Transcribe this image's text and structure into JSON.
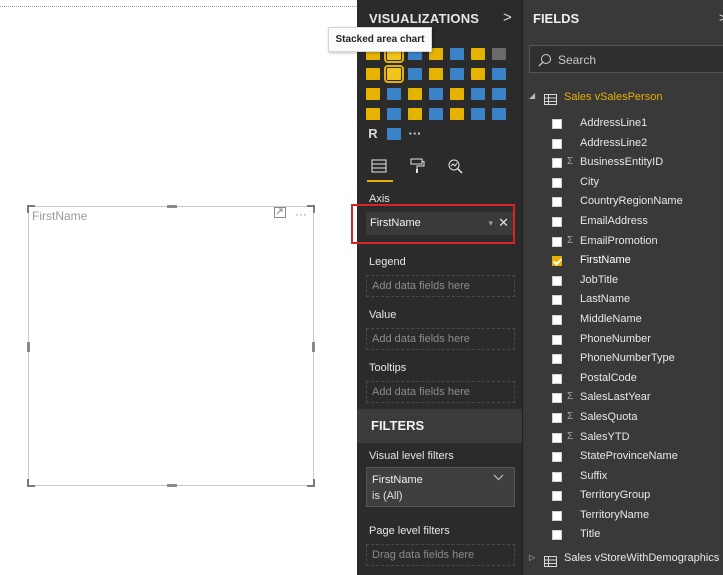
{
  "canvas": {
    "visual_title": "FirstName",
    "focus_icon": "focus-mode-icon",
    "more_icon": "···"
  },
  "visualizations": {
    "header": "VISUALIZATIONS",
    "collapse_glyph": ">",
    "tooltip": "Stacked area chart",
    "gallery": [
      {
        "name": "stacked-bar-chart-icon",
        "color": "#e6b400"
      },
      {
        "name": "stacked-column-chart-icon",
        "color": "#f0c419",
        "selected": true
      },
      {
        "name": "clustered-bar-chart-icon",
        "color": "#3b83c9"
      },
      {
        "name": "clustered-column-chart-icon",
        "color": "#e6b400"
      },
      {
        "name": "100-percent-bar-chart-icon",
        "color": "#3b83c9"
      },
      {
        "name": "100-percent-column-chart-icon",
        "color": "#e6b400"
      },
      {
        "name": "line-chart-icon",
        "color": "#6a6a6a"
      },
      {
        "name": "area-chart-icon",
        "color": "#e6b400"
      },
      {
        "name": "stacked-area-chart-icon",
        "color": "#f0c419",
        "selected": true
      },
      {
        "name": "line-and-stacked-column-icon",
        "color": "#3b83c9"
      },
      {
        "name": "line-and-clustered-column-icon",
        "color": "#e6b400"
      },
      {
        "name": "ribbon-chart-icon",
        "color": "#3b83c9"
      },
      {
        "name": "waterfall-chart-icon",
        "color": "#e6b400"
      },
      {
        "name": "scatter-chart-icon",
        "color": "#3b83c9"
      },
      {
        "name": "pie-chart-icon",
        "color": "#e6b400"
      },
      {
        "name": "donut-chart-icon",
        "color": "#3b83c9"
      },
      {
        "name": "treemap-icon",
        "color": "#e6b400"
      },
      {
        "name": "map-icon",
        "color": "#3b83c9"
      },
      {
        "name": "filled-map-icon",
        "color": "#e6b400"
      },
      {
        "name": "shape-map-icon",
        "color": "#3b83c9"
      },
      {
        "name": "funnel-icon",
        "color": "#3b83c9"
      },
      {
        "name": "gauge-icon",
        "color": "#e6b400"
      },
      {
        "name": "card-icon",
        "color": "#3b83c9"
      },
      {
        "name": "multi-row-card-icon",
        "color": "#e6b400"
      },
      {
        "name": "kpi-icon",
        "color": "#3b83c9"
      },
      {
        "name": "slicer-icon",
        "color": "#e6b400"
      },
      {
        "name": "table-icon",
        "color": "#3b83c9"
      },
      {
        "name": "matrix-icon",
        "color": "#3b83c9"
      },
      {
        "name": "r-visual-icon",
        "color": "#d8d8d8",
        "glyph": "R"
      },
      {
        "name": "globe-icon",
        "color": "#3b83c9"
      },
      {
        "name": "more-visuals-icon",
        "color": "#d8d8d8",
        "glyph": "···"
      }
    ],
    "tabs": [
      "fields-tab-icon",
      "format-paint-roller-icon",
      "analytics-magnifier-icon"
    ],
    "axis_label": "Axis",
    "axis_field": "FirstName",
    "legend_label": "Legend",
    "legend_placeholder": "Add data fields here",
    "value_label": "Value",
    "value_placeholder": "Add data fields here",
    "tooltips_label": "Tooltips",
    "tooltips_placeholder": "Add data fields here",
    "filters_header": "FILTERS",
    "visual_level_label": "Visual level filters",
    "filter_field": "FirstName",
    "filter_value": "is (All)",
    "page_level_label": "Page level filters",
    "page_level_placeholder": "Drag data fields here"
  },
  "fields": {
    "header": "FIELDS",
    "search_placeholder": "Search",
    "table_name": "Sales vSalesPerson",
    "items": [
      {
        "label": "AddressLine1",
        "sigma": false,
        "checked": false
      },
      {
        "label": "AddressLine2",
        "sigma": false,
        "checked": false
      },
      {
        "label": "BusinessEntityID",
        "sigma": true,
        "checked": false
      },
      {
        "label": "City",
        "sigma": false,
        "checked": false
      },
      {
        "label": "CountryRegionName",
        "sigma": false,
        "checked": false
      },
      {
        "label": "EmailAddress",
        "sigma": false,
        "checked": false
      },
      {
        "label": "EmailPromotion",
        "sigma": true,
        "checked": false
      },
      {
        "label": "FirstName",
        "sigma": false,
        "checked": true
      },
      {
        "label": "JobTitle",
        "sigma": false,
        "checked": false
      },
      {
        "label": "LastName",
        "sigma": false,
        "checked": false
      },
      {
        "label": "MiddleName",
        "sigma": false,
        "checked": false
      },
      {
        "label": "PhoneNumber",
        "sigma": false,
        "checked": false
      },
      {
        "label": "PhoneNumberType",
        "sigma": false,
        "checked": false
      },
      {
        "label": "PostalCode",
        "sigma": false,
        "checked": false
      },
      {
        "label": "SalesLastYear",
        "sigma": true,
        "checked": false
      },
      {
        "label": "SalesQuota",
        "sigma": true,
        "checked": false
      },
      {
        "label": "SalesYTD",
        "sigma": true,
        "checked": false
      },
      {
        "label": "StateProvinceName",
        "sigma": false,
        "checked": false
      },
      {
        "label": "Suffix",
        "sigma": false,
        "checked": false
      },
      {
        "label": "TerritoryGroup",
        "sigma": false,
        "checked": false
      },
      {
        "label": "TerritoryName",
        "sigma": false,
        "checked": false
      },
      {
        "label": "Title",
        "sigma": false,
        "checked": false
      }
    ],
    "sigma_glyph": "Σ",
    "table2_name": "Sales vStoreWithDemographics"
  }
}
